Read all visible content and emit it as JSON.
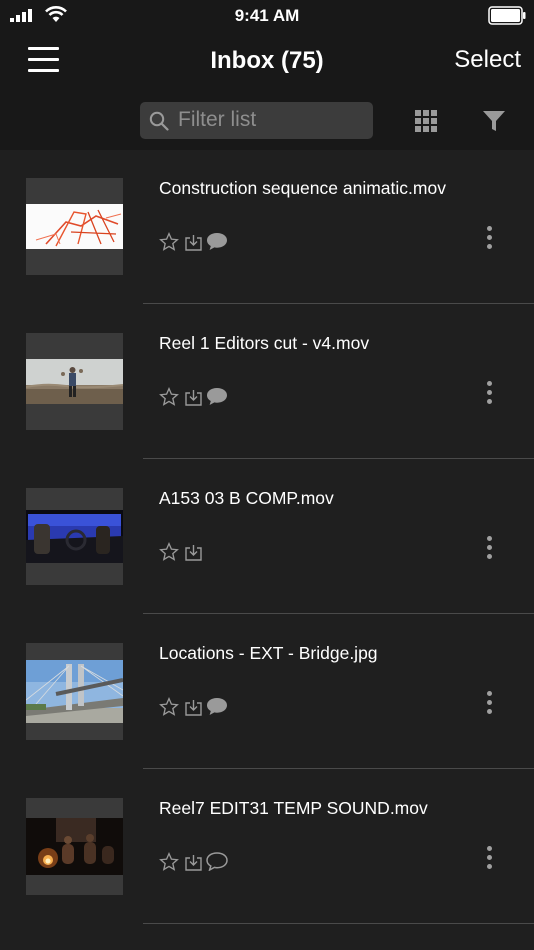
{
  "status_bar": {
    "time": "9:41 AM"
  },
  "nav": {
    "title": "Inbox (75)",
    "select_label": "Select",
    "menu_icon": "hamburger-menu-icon"
  },
  "filter": {
    "placeholder": "Filter list",
    "grid_icon": "grid-view-icon",
    "filter_icon": "funnel-filter-icon"
  },
  "files": [
    {
      "name": "Construction sequence animatic.mov",
      "thumbnail": "sketch-animatic-frame",
      "comment_icon": "comment-filled-icon"
    },
    {
      "name": "Reel 1 Editors cut - v4.mov",
      "thumbnail": "person-in-field-frame",
      "comment_icon": "comment-filled-icon"
    },
    {
      "name": "A153 03 B COMP.mov",
      "thumbnail": "car-interior-frame",
      "comment_icon": null
    },
    {
      "name": "Locations - EXT - Bridge.jpg",
      "thumbnail": "bridge-photo",
      "comment_icon": "comment-filled-icon"
    },
    {
      "name": "Reel7 EDIT31 TEMP SOUND.mov",
      "thumbnail": "campfire-night-frame",
      "comment_icon": "comment-outline-icon"
    }
  ],
  "colors": {
    "background": "#1f1f1f",
    "header": "#181818",
    "search_field": "#3c3c3c",
    "icon_gray": "#9a9a9a",
    "divider": "#4a4a4a"
  }
}
